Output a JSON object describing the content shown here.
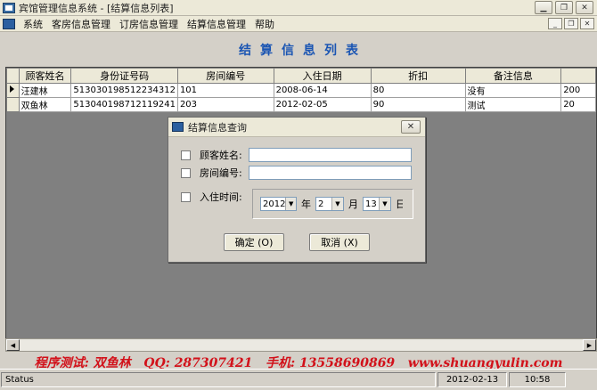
{
  "window": {
    "title": "宾馆管理信息系统 - [结算信息列表]"
  },
  "menu": {
    "items": [
      "系统",
      "客房信息管理",
      "订房信息管理",
      "结算信息管理",
      "帮助"
    ]
  },
  "page": {
    "title": "结算信息列表"
  },
  "table": {
    "columns": [
      "顾客姓名",
      "身份证号码",
      "房间编号",
      "入住日期",
      "折扣",
      "备注信息",
      ""
    ],
    "rows": [
      {
        "name": "汪建林",
        "id_card": "513030198512234312",
        "room": "101",
        "checkin": "2008-06-14",
        "discount": "80",
        "note": "没有",
        "extra": "200"
      },
      {
        "name": "双鱼林",
        "id_card": "513040198712119241",
        "room": "203",
        "checkin": "2012-02-05",
        "discount": "90",
        "note": "测试",
        "extra": "20"
      }
    ]
  },
  "dialog": {
    "title": "结算信息查询",
    "fields": {
      "name_label": "顾客姓名:",
      "room_label": "房间编号:",
      "date_label": "入住时间:"
    },
    "date": {
      "year": "2012",
      "year_unit": "年",
      "month": "2",
      "month_unit": "月",
      "day": "13",
      "day_unit": "日"
    },
    "ok_label": "确定 (O)",
    "cancel_label": "取消 (X)"
  },
  "watermark": "程序测试: 双鱼林   QQ: 287307421   手机: 13558690869   www.shuangyulin.com",
  "status": {
    "text": "Status",
    "date": "2012-02-13",
    "time": "10:58"
  }
}
